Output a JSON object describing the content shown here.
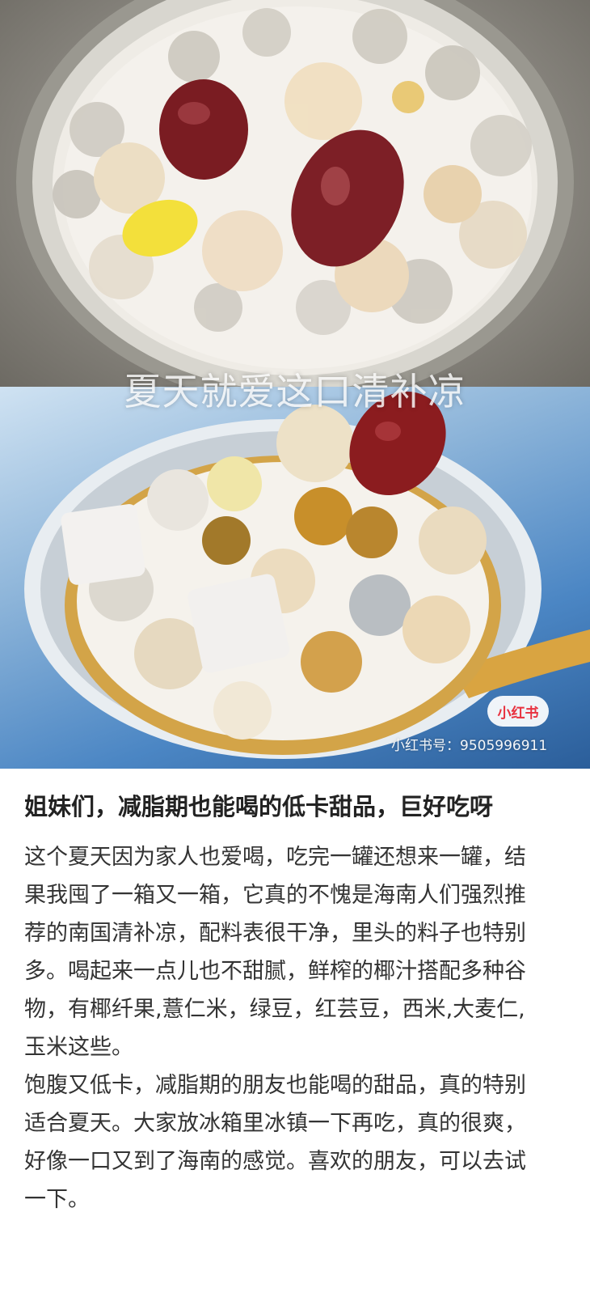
{
  "images": {
    "overlay_caption": "夏天就爱这口清补凉",
    "watermark_logo": "小红书",
    "watermark_id": "小红书号：9505996911"
  },
  "post": {
    "title": "姐妹们，减脂期也能喝的低卡甜品，巨好吃呀",
    "paragraph_1": "这个夏天因为家人也爱喝，吃完一罐还想来一罐，结果我囤了一箱又一箱，它真的不愧是海南人们强烈推荐的南国清补凉，配料表很干净，里头的料子也特别多。喝起来一点儿也不甜腻，鲜榨的椰汁搭配多种谷物，有椰纤果,薏仁米，绿豆，红芸豆，西米,大麦仁,玉米这些。",
    "paragraph_2": "饱腹又低卡，减脂期的朋友也能喝的甜品，真的特别适合夏天。大家放冰箱里冰镇一下再吃，真的很爽，好像一口又到了海南的感觉。喜欢的朋友，可以去试一下。"
  }
}
